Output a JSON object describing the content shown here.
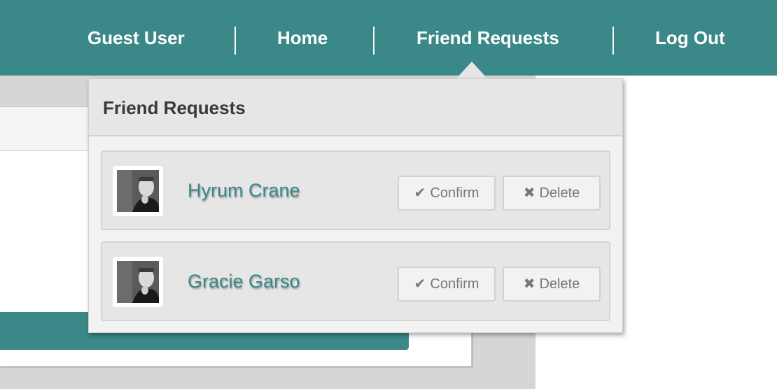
{
  "nav": {
    "items": [
      {
        "label": "Guest User"
      },
      {
        "label": "Home"
      },
      {
        "label": "Friend Requests"
      },
      {
        "label": "Log Out"
      }
    ]
  },
  "dropdown": {
    "title": "Friend Requests",
    "requests": [
      {
        "name": "Hyrum Crane",
        "avatar_icon": "profile-photo",
        "confirm_label": "Confirm",
        "confirm_icon": "✔",
        "delete_label": "Delete",
        "delete_icon": "✖"
      },
      {
        "name": "Gracie Garso",
        "avatar_icon": "profile-photo",
        "confirm_label": "Confirm",
        "confirm_icon": "✔",
        "delete_label": "Delete",
        "delete_icon": "✖"
      }
    ]
  },
  "colors": {
    "brand": "#3b8888",
    "panel": "#e6e6e6",
    "button_text": "#777777"
  }
}
